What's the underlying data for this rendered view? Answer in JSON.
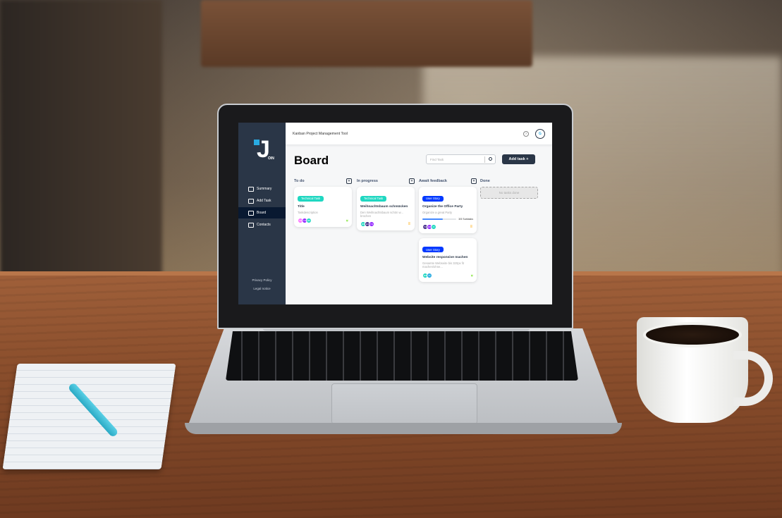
{
  "app": {
    "logo_letter": "J",
    "logo_suffix": "OIN",
    "header_title": "Kanban Project Management Tool",
    "help_label": "?",
    "user_initials": "G"
  },
  "sidebar": {
    "items": [
      {
        "label": "Summary",
        "icon": "summary-icon"
      },
      {
        "label": "Add Task",
        "icon": "edit-icon"
      },
      {
        "label": "Board",
        "icon": "board-icon",
        "active": true
      },
      {
        "label": "Contacts",
        "icon": "contacts-icon"
      }
    ],
    "footer": [
      "Privacy Policy",
      "Legal notice"
    ]
  },
  "board": {
    "title": "Board",
    "search_placeholder": "Find Task",
    "add_task_label": "Add task +",
    "columns": [
      {
        "title": "To do",
        "add_label": "+",
        "cards": [
          {
            "category": "Technical Task",
            "category_color": "#1fd7c1",
            "title": "Title",
            "description": "Taskdescription",
            "assignees": [
              {
                "initials": "OE",
                "color": "#fc71ff"
              },
              {
                "initials": "TM",
                "color": "#9327ff"
              },
              {
                "initials": "MB",
                "color": "#1fd7c1"
              }
            ],
            "priority": "low",
            "priority_glyph": "»",
            "priority_color": "#7ae229"
          }
        ]
      },
      {
        "title": "In progress",
        "add_label": "+",
        "cards": [
          {
            "category": "Technical Task",
            "category_color": "#1fd7c1",
            "title": "Weihnachtsbaum schmücken",
            "description": "Den Weihnachtsbaum schön w... brochen",
            "assignees": [
              {
                "initials": "MB",
                "color": "#1fd7c1"
              },
              {
                "initials": "EC",
                "color": "#462f8a"
              },
              {
                "initials": "TM",
                "color": "#9327ff"
              }
            ],
            "priority": "medium",
            "priority_glyph": "≡",
            "priority_color": "#ffa800"
          }
        ]
      },
      {
        "title": "Await feedback",
        "add_label": "+",
        "cards": [
          {
            "category": "User Story",
            "category_color": "#0038ff",
            "title": "Organize the Office Party",
            "description": "Organize a great Party",
            "progress": 0.6,
            "subtasks_label": "3/5 Subtasks",
            "assignees": [
              {
                "initials": "TM",
                "color": "#462f8a"
              },
              {
                "initials": "MB",
                "color": "#9327ff"
              },
              {
                "initials": "PI",
                "color": "#1fd7c1"
              }
            ],
            "priority": "medium",
            "priority_glyph": "≡",
            "priority_color": "#ffa800"
          },
          {
            "category": "User Story",
            "category_color": "#0038ff",
            "title": "Website responsive machen",
            "description": "Gesamte Webseite bis 320px fit machen/ohne...",
            "assignees": [
              {
                "initials": "MB",
                "color": "#1fd7c1"
              },
              {
                "initials": "PI",
                "color": "#29abe2"
              }
            ],
            "priority": "low",
            "priority_glyph": "»",
            "priority_color": "#7ae229"
          }
        ]
      },
      {
        "title": "Done",
        "empty_label": "No tasks done",
        "cards": []
      }
    ]
  }
}
